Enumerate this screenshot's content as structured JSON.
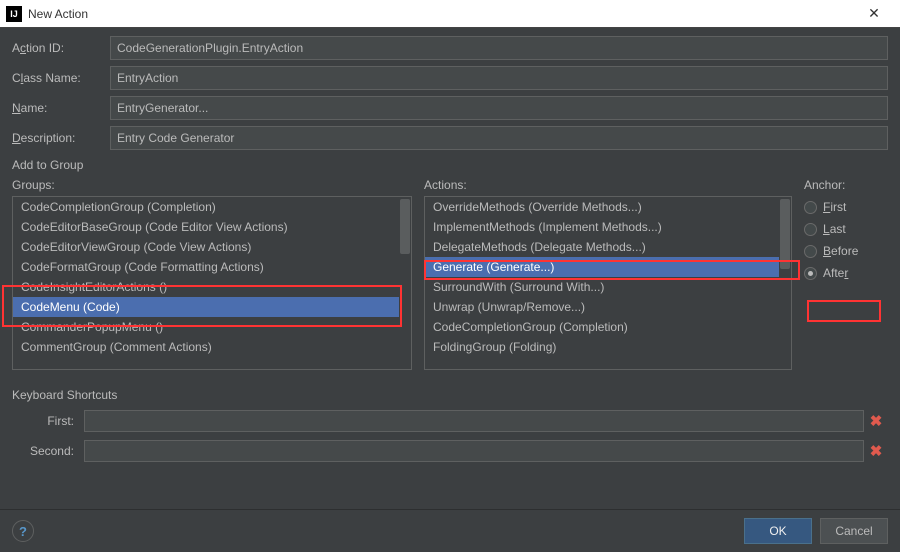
{
  "window": {
    "title": "New Action"
  },
  "form": {
    "action_id": {
      "label_pre": "A",
      "label_ul": "c",
      "label_post": "tion ID:",
      "value": "CodeGenerationPlugin.EntryAction"
    },
    "class_name": {
      "label_pre": "C",
      "label_ul": "l",
      "label_post": "ass Name:",
      "value": "EntryAction"
    },
    "name": {
      "label_pre": "",
      "label_ul": "N",
      "label_post": "ame:",
      "value": "EntryGenerator..."
    },
    "description": {
      "label_pre": "",
      "label_ul": "D",
      "label_post": "escription:",
      "value": "Entry Code Generator"
    }
  },
  "add_to_group_label": "Add to Group",
  "groups": {
    "header_pre": "",
    "header_ul": "G",
    "header_post": "roups:",
    "items": [
      "CodeCompletionGroup (Completion)",
      "CodeEditorBaseGroup (Code Editor View Actions)",
      "CodeEditorViewGroup (Code View Actions)",
      "CodeFormatGroup (Code Formatting Actions)",
      "CodeInsightEditorActions ()",
      "CodeMenu (Code)",
      "CommanderPopupMenu ()",
      "CommentGroup (Comment Actions)"
    ],
    "selected_index": 5
  },
  "actions": {
    "header_pre": "Ac",
    "header_ul": "t",
    "header_post": "ions:",
    "items": [
      "OverrideMethods (Override Methods...)",
      "ImplementMethods (Implement Methods...)",
      "DelegateMethods (Delegate Methods...)",
      "Generate (Generate...)",
      "SurroundWith (Surround With...)",
      "Unwrap (Unwrap/Remove...)",
      "CodeCompletionGroup (Completion)",
      "FoldingGroup (Folding)"
    ],
    "selected_index": 3
  },
  "anchor": {
    "header": "Anchor:",
    "options": [
      {
        "pre": "",
        "ul": "F",
        "post": "irst",
        "selected": false
      },
      {
        "pre": "",
        "ul": "L",
        "post": "ast",
        "selected": false
      },
      {
        "pre": "",
        "ul": "B",
        "post": "efore",
        "selected": false
      },
      {
        "pre": "Afte",
        "ul": "r",
        "post": "",
        "selected": true
      }
    ]
  },
  "shortcuts": {
    "header": "Keyboard Shortcuts",
    "first_label": "First:",
    "second_label": "Second:"
  },
  "footer": {
    "ok": "OK",
    "cancel": "Cancel"
  }
}
